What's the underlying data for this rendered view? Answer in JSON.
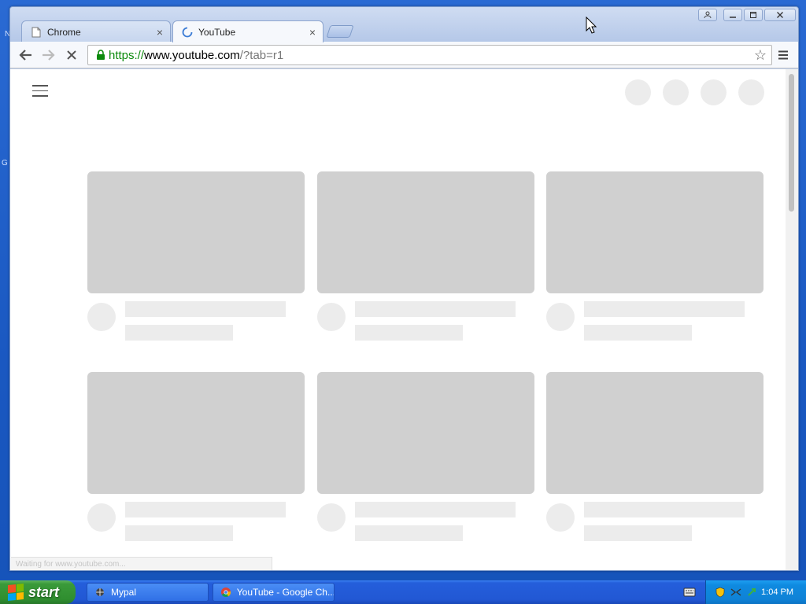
{
  "desktop": {
    "marks": [
      "N",
      "G"
    ]
  },
  "browser": {
    "tabs": [
      {
        "title": "Chrome",
        "active": false,
        "icon": "page-icon"
      },
      {
        "title": "YouTube",
        "active": true,
        "icon": "loading-spinner-icon"
      }
    ],
    "url": {
      "scheme": "https://",
      "host": "www.youtube.com",
      "rest": "/?tab=r1"
    },
    "status_text": "Waiting for www.youtube.com..."
  },
  "page": {
    "placeholder_rows": 2,
    "placeholder_cols": 3
  },
  "taskbar": {
    "start_label": "start",
    "tasks": [
      {
        "label": "Mypal",
        "icon": "mypal-icon"
      },
      {
        "label": "YouTube - Google Ch...",
        "icon": "chrome-icon"
      }
    ],
    "clock": "1:04 PM"
  },
  "colors": {
    "desktop": "#1b5cc4",
    "skeleton_dark": "#d0d0d0",
    "skeleton_light": "#ececec",
    "url_secure": "#0b8a0b"
  }
}
